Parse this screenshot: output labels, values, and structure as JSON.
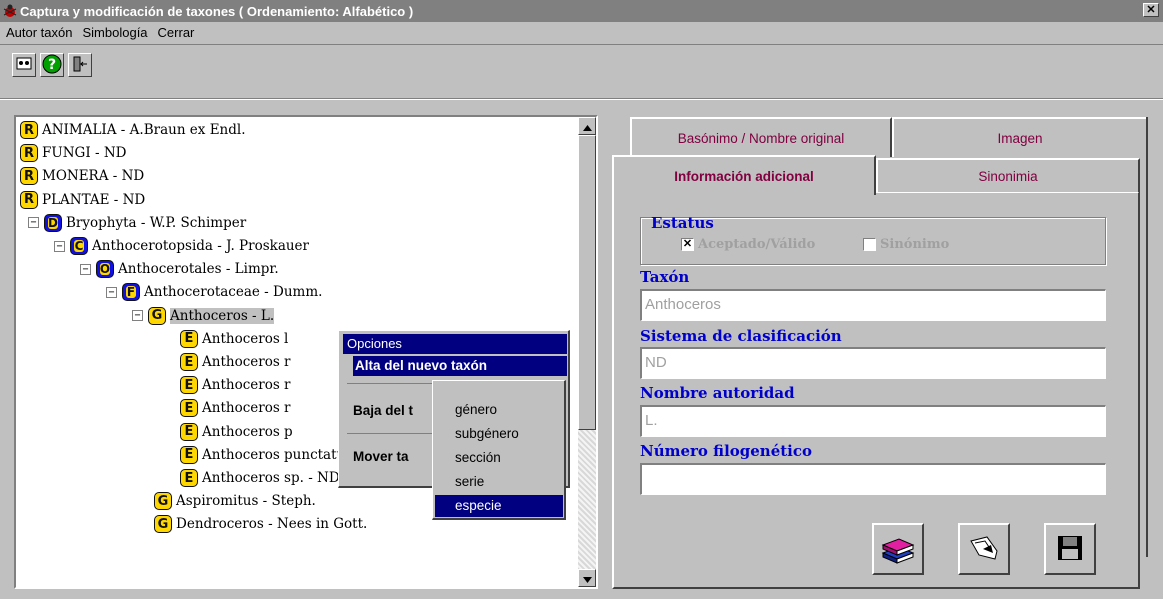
{
  "window": {
    "title": "Captura y modificación de taxones  ( Ordenamiento: Alfabético )",
    "close_glyph": "✕"
  },
  "menu": [
    "Autor taxón",
    "Simbología",
    "Cerrar"
  ],
  "toolbar": {
    "icons": [
      "users-exchange-icon",
      "help-icon",
      "exit-door-icon"
    ]
  },
  "tree": {
    "rows": [
      {
        "icon": "R",
        "label": "ANIMALIA - A.Braun ex Endl.",
        "indent": 0
      },
      {
        "icon": "R",
        "label": "FUNGI - ND",
        "indent": 0
      },
      {
        "icon": "R",
        "label": "MONERA - ND",
        "indent": 0
      },
      {
        "icon": "R",
        "label": "PLANTAE - ND",
        "indent": 0
      },
      {
        "icon": "D",
        "label": "Bryophyta - W.P. Schimper",
        "indent": 1,
        "expander": "−"
      },
      {
        "icon": "C",
        "label": "Anthocerotopsida - J. Proskauer",
        "indent": 2,
        "expander": "−"
      },
      {
        "icon": "O",
        "label": "Anthocerotales - Limpr.",
        "indent": 3,
        "expander": "−"
      },
      {
        "icon": "F",
        "label": "Anthocerotaceae - Dumm.",
        "indent": 4,
        "expander": "−"
      },
      {
        "icon": "G",
        "label": "Anthoceros - L.",
        "indent": 5,
        "expander": "−",
        "selected": true
      },
      {
        "icon": "E",
        "label": "Anthoceros l",
        "indent": 6
      },
      {
        "icon": "E",
        "label": "Anthoceros r",
        "indent": 6
      },
      {
        "icon": "E",
        "label": "Anthoceros r",
        "indent": 6
      },
      {
        "icon": "E",
        "label": "Anthoceros r",
        "indent": 6
      },
      {
        "icon": "E",
        "label": "Anthoceros p",
        "indent": 6
      },
      {
        "icon": "E",
        "label": "Anthoceros punctatus -",
        "indent": 6
      },
      {
        "icon": "E",
        "label": "Anthoceros sp. - ND",
        "indent": 6
      },
      {
        "icon": "G",
        "label": "Aspiromitus - Steph.",
        "indent": 5
      },
      {
        "icon": "G",
        "label": "Dendroceros - Nees in Gott.",
        "indent": 5
      }
    ]
  },
  "context_menu": {
    "title": "Opciones",
    "items": [
      "Alta del nuevo taxón",
      "Baja del t",
      "Mover ta"
    ]
  },
  "submenu": {
    "items": [
      "género",
      "subgénero",
      "sección",
      "serie",
      "especie"
    ]
  },
  "tabs": {
    "back": [
      "Basónimo / Nombre original",
      "Imagen"
    ],
    "front": [
      "Información adicional",
      "Sinonimia"
    ]
  },
  "form": {
    "status_title": "Estatus",
    "accepted_label": "Aceptado/Válido",
    "accepted_mark": "✕",
    "synonym_label": "Sinónimo",
    "taxon_label": "Taxón",
    "taxon_value": "Anthoceros",
    "system_label": "Sistema de clasificación",
    "system_value": "ND",
    "authority_label": "Nombre autoridad",
    "authority_value": "L.",
    "phylo_label": "Número filogenético",
    "phylo_value": ""
  },
  "buttons": {
    "icons": [
      "books-icon",
      "hand-edit-icon",
      "save-floppy-icon"
    ]
  },
  "colors": {
    "title_bar": "#808080",
    "highlight": "#000080",
    "label_blue": "#0000cc",
    "icon_yellow": "#ffd700",
    "tab_active_text": "#800040",
    "tab_text": "#800040"
  }
}
